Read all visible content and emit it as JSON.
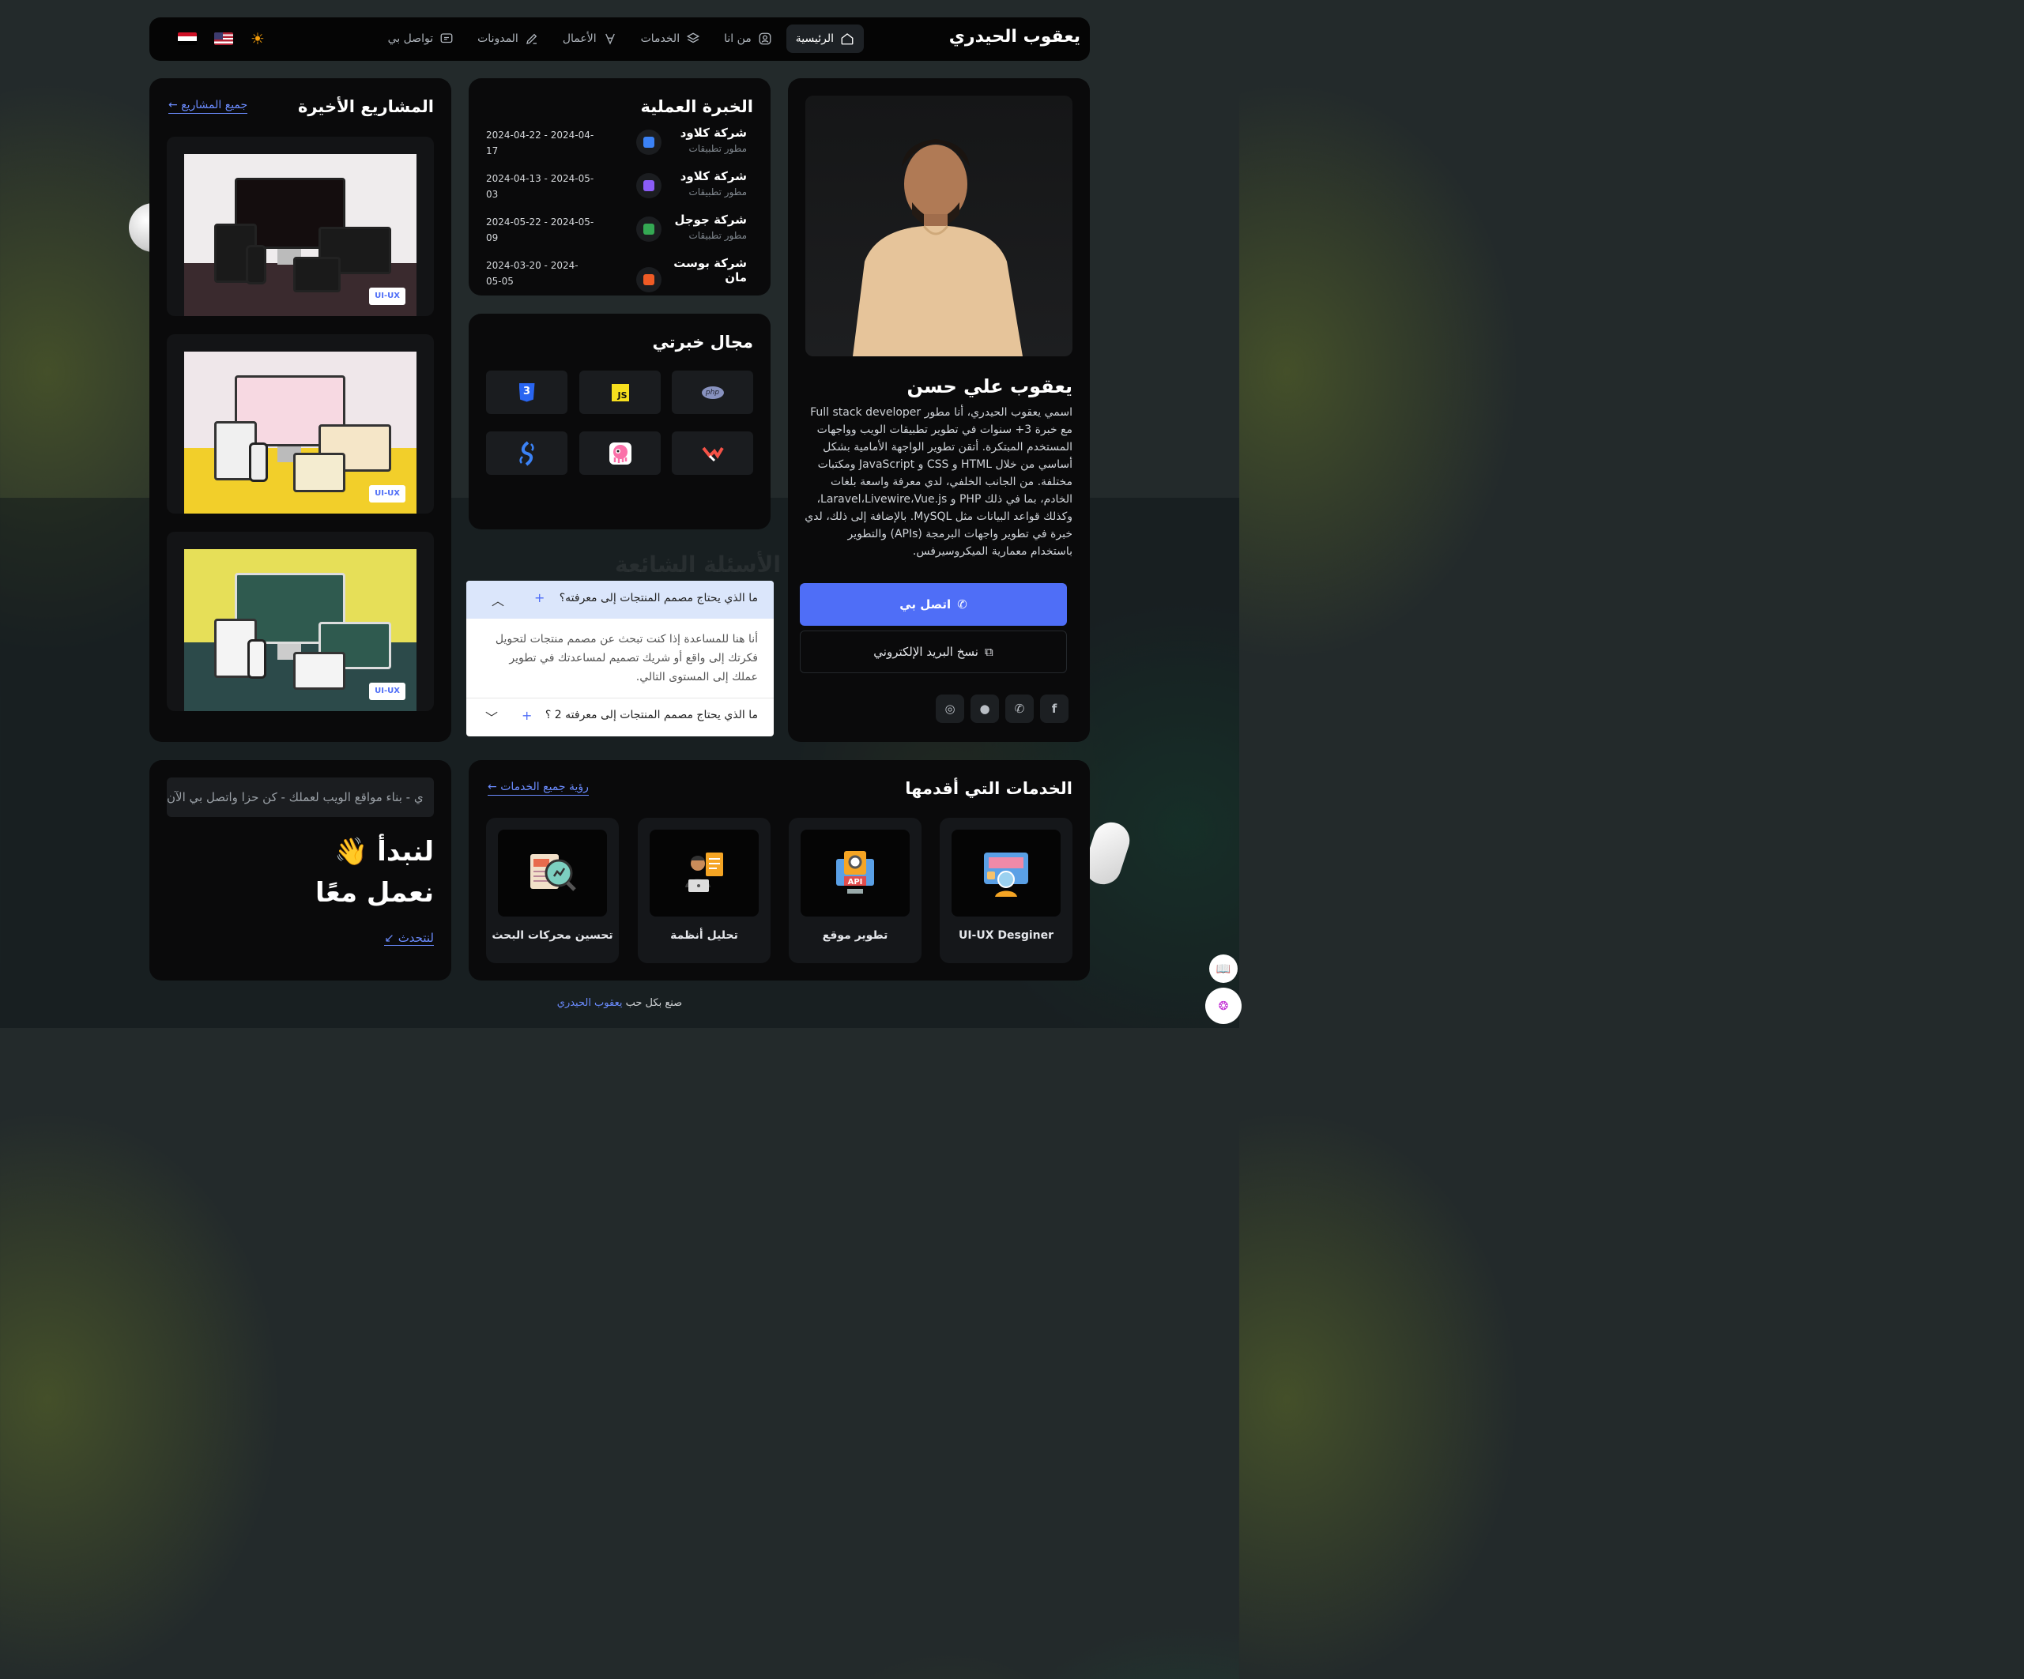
{
  "nav": {
    "brand": "يعقوب الحيدري",
    "items": [
      {
        "label": "الرئيسية",
        "icon": "home-icon",
        "active": true
      },
      {
        "label": "من انا",
        "icon": "user-icon"
      },
      {
        "label": "الخدمات",
        "icon": "layers-icon"
      },
      {
        "label": "الأعمال",
        "icon": "brush-icon"
      },
      {
        "label": "المدونات",
        "icon": "pen-icon"
      },
      {
        "label": "تواصل بي",
        "icon": "message-icon"
      }
    ],
    "theme_icon": "sun-icon",
    "flags": [
      "us-flag-icon",
      "yemen-flag-icon"
    ]
  },
  "profile": {
    "name": "يعقوب علي حسن",
    "bio": "اسمي يعقوب الحيدري، أنا مطور Full stack developer مع خبرة 3+ سنوات في تطوير تطبيقات الويب وواجهات المستخدم المبتكرة. أتقن تطوير الواجهة الأمامية بشكل أساسي من خلال HTML و CSS و JavaScript ومكتبات مختلفة. من الجانب الخلفي، لدي معرفة واسعة بلغات الخادم، بما في ذلك PHP و Laravel،Livewire،Vue.js، وكذلك قواعد البيانات مثل MySQL. بالإضافة إلى ذلك، لدي خبرة في تطوير واجهات البرمجة (APIs) والتطوير باستخدام معمارية الميكروسيرفس.",
    "contact_label": "اتصل بي",
    "copy_email_label": "نسخ البريد الإلكتروني",
    "socials": [
      "instagram-icon",
      "github-icon",
      "whatsapp-icon",
      "facebook-icon"
    ]
  },
  "experience": {
    "title": "الخبرة العملية",
    "items": [
      {
        "company": "شركة كلاود",
        "role": "مطور تطبيقات",
        "date": "2024-04-22 - 2024-04-17",
        "color": "#3b82f6"
      },
      {
        "company": "شركة كلاود",
        "role": "مطور تطبيقات",
        "date": "2024-04-13 - 2024-05-03",
        "color": "#8b5cf6"
      },
      {
        "company": "شركة جوجل",
        "role": "مطور تطبيقات",
        "date": "2024-05-22 - 2024-05-09",
        "color": "#34a853"
      },
      {
        "company": "شركة بوست مان",
        "role": "مطور تطبيقات",
        "date": "2024-03-20 - 2024-05-05",
        "color": "#ef5b25"
      }
    ]
  },
  "skills": {
    "title": "مجال خبرتي",
    "items": [
      "php-icon",
      "js-icon",
      "css3-icon",
      "laravel-icon",
      "livewire-icon",
      "swagger-icon"
    ],
    "php_text": "php",
    "js_text": "JS",
    "css_text": "3"
  },
  "faq": {
    "title": "الأسئلة الشائعة",
    "items": [
      {
        "question": "ما الذي يحتاج مصمم المنتجات إلى معرفته؟",
        "answer": "أنا هنا للمساعدة إذا كنت تبحث عن مصمم منتجات لتحويل فكرتك إلى واقع أو شريك تصميم لمساعدتك في تطوير عملك إلى المستوى التالي.",
        "open": true
      },
      {
        "question": "ما الذي يحتاج مصمم المنتجات إلى معرفته 2 ؟",
        "answer": "",
        "open": false
      }
    ]
  },
  "projects": {
    "title": "المشاريع الأخيرة",
    "all_link": "جميع المشاريع",
    "items": [
      {
        "tag": "UI-UX",
        "bg": "#efeced",
        "floor": "#3a2a2e"
      },
      {
        "tag": "UI-UX",
        "bg": "#efe7ea",
        "floor": "#f2cf2a"
      },
      {
        "tag": "UI-UX",
        "bg": "#e6df58",
        "floor": "#2c4a4a"
      }
    ]
  },
  "services": {
    "title": "الخدمات التي أقدمها",
    "all_link": "رؤية جميع الخدمات",
    "items": [
      {
        "label": "UI-UX Desginer",
        "icon": "ui-design-icon"
      },
      {
        "label": "تطوير موقع",
        "icon": "api-icon"
      },
      {
        "label": "تحليل أنظمة",
        "icon": "analyst-icon"
      },
      {
        "label": "تحسين محركات البحث",
        "icon": "seo-icon"
      }
    ]
  },
  "cta": {
    "marquee": "ي - بناء مواقع الويب لعملك - كن حزا واتصل بي الآن",
    "line1": "لنبدأ 👋",
    "line2": "نعمل معًا",
    "talk_link": "لنتحدث"
  },
  "footer": {
    "text": "صنع بكل حب",
    "author": "يعقوب الحيدري"
  },
  "floating": {
    "reader_icon": "book-icon",
    "brain_icon": "brain-icon"
  }
}
